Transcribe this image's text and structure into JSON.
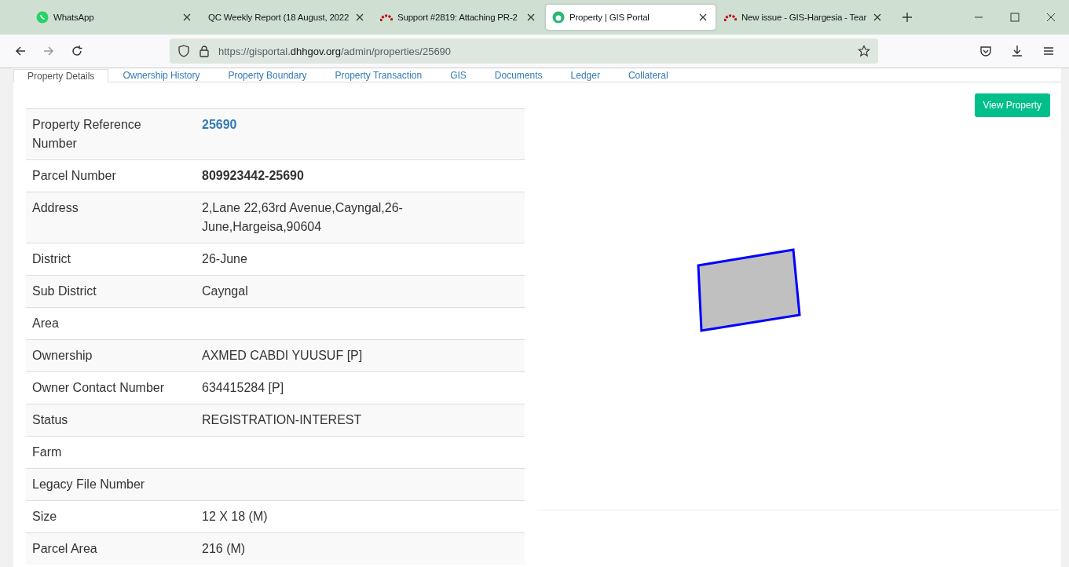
{
  "browser_tabs": [
    {
      "title": "WhatsApp",
      "kind": "chat",
      "selected": false
    },
    {
      "title": "QC Weekly Report (18 August, 2022",
      "kind": "plain",
      "selected": false
    },
    {
      "title": "Support #2819: Attaching PR-2",
      "kind": "arc",
      "selected": false
    },
    {
      "title": "Property | GIS Portal",
      "kind": "globe",
      "selected": true
    },
    {
      "title": "New issue - GIS-Hargesia - Tear",
      "kind": "arc",
      "selected": false
    }
  ],
  "address_bar": {
    "url_prefix": "https://gisportal.",
    "url_domain": "dhhgov.org",
    "url_path": "/admin/properties/25690"
  },
  "page_tabs": [
    {
      "label": "Property Details",
      "selected": true
    },
    {
      "label": "Ownership History",
      "selected": false
    },
    {
      "label": "Property Boundary",
      "selected": false
    },
    {
      "label": "Property Transaction",
      "selected": false
    },
    {
      "label": "GIS",
      "selected": false
    },
    {
      "label": "Documents",
      "selected": false
    },
    {
      "label": "Ledger",
      "selected": false
    },
    {
      "label": "Collateral",
      "selected": false
    }
  ],
  "details": [
    {
      "label": "Property Reference Number",
      "value": "25690",
      "kind": "link"
    },
    {
      "label": "Parcel Number",
      "value": "809923442-25690",
      "kind": "bold"
    },
    {
      "label": "Address",
      "value": "2,Lane 22,63rd Avenue,Cayngal,26-June,Hargeisa,90604",
      "kind": "plain"
    },
    {
      "label": "District",
      "value": "26-June",
      "kind": "plain"
    },
    {
      "label": "Sub District",
      "value": "Cayngal",
      "kind": "plain"
    },
    {
      "label": "Area",
      "kind": "plain"
    },
    {
      "label": "Ownership",
      "value": "AXMED CABDI YUUSUF [P]",
      "kind": "plain"
    },
    {
      "label": "Owner Contact Number",
      "value": "634415284 [P]",
      "kind": "plain"
    },
    {
      "label": "Status",
      "value": "REGISTRATION-INTEREST",
      "kind": "plain"
    },
    {
      "label": "Farm",
      "kind": "plain"
    },
    {
      "label": "Legacy File Number",
      "kind": "plain"
    },
    {
      "label": "Size",
      "value": "12 X 18 (M)",
      "kind": "plain"
    },
    {
      "label": "Parcel Area",
      "value": "216 (M)",
      "kind": "plain"
    }
  ],
  "view_button": "View Property"
}
